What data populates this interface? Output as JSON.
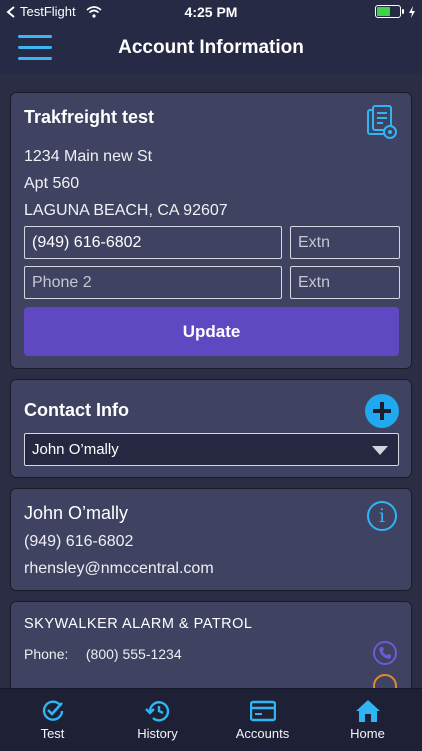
{
  "status": {
    "carrier": "TestFlight",
    "time": "4:25 PM",
    "battery_percent": 60,
    "battery_color": "#3fd34a"
  },
  "nav": {
    "title": "Account Information",
    "menu_icon": "hamburger-menu-icon"
  },
  "account": {
    "name": "Trakfreight test",
    "address1": "1234 Main new St",
    "address2": "Apt 560",
    "city_line": "LAGUNA BEACH, CA 92607",
    "phone1": "(949) 616-6802",
    "phone1_ext_placeholder": "Extn",
    "phone2_placeholder": "Phone 2",
    "phone2_ext_placeholder": "Extn",
    "update_label": "Update",
    "update_color": "#6048c2",
    "doc_icon": "document-view-icon"
  },
  "contact_info": {
    "title": "Contact Info",
    "selected": "John O’mally",
    "add_icon": "plus-circle-icon"
  },
  "contact_person": {
    "name": "John O’mally",
    "phone": "(949) 616-6802",
    "email": "rhensley@nmccentral.com",
    "info_icon": "info-icon"
  },
  "company": {
    "name": "SKYWALKER ALARM & PATROL",
    "phone_label": "Phone:",
    "phone": "(800) 555-1234"
  },
  "tabs": [
    {
      "label": "Test",
      "icon": "check-circle-icon"
    },
    {
      "label": "History",
      "icon": "history-icon"
    },
    {
      "label": "Accounts",
      "icon": "card-icon"
    },
    {
      "label": "Home",
      "icon": "home-icon"
    }
  ],
  "colors": {
    "accent": "#2fb4f4",
    "background": "#2a2d44",
    "card": "#3f4260"
  }
}
